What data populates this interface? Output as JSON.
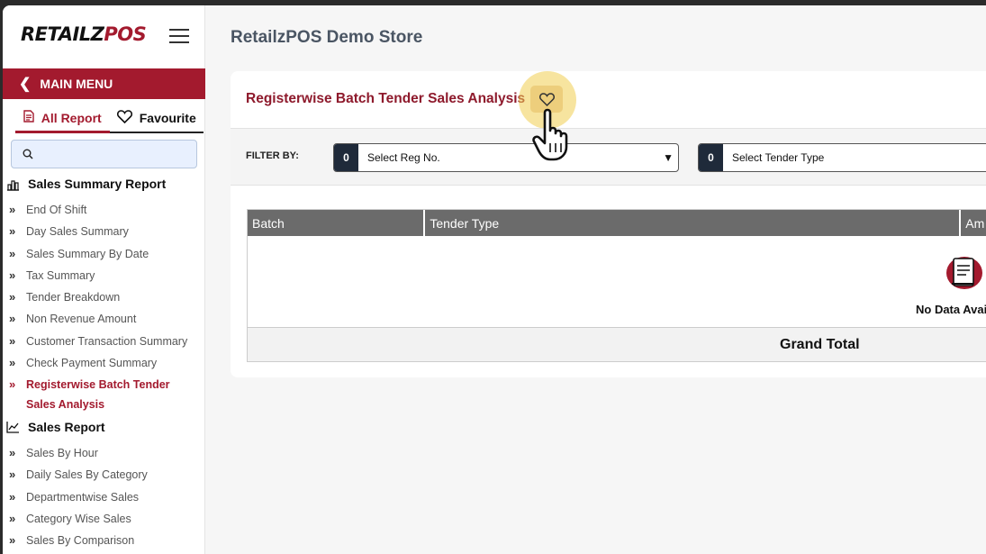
{
  "sidebar": {
    "logo": {
      "part1": "RETAIL",
      "part2": "Z",
      "part3": "POS"
    },
    "main_menu": "MAIN MENU",
    "tabs": [
      {
        "label": "All Report"
      },
      {
        "label": "Favourite"
      }
    ],
    "sections": [
      {
        "title": "Sales Summary Report",
        "items": [
          {
            "label": "End Of Shift"
          },
          {
            "label": "Day Sales Summary"
          },
          {
            "label": "Sales Summary By Date"
          },
          {
            "label": "Tax Summary"
          },
          {
            "label": "Tender Breakdown"
          },
          {
            "label": "Non Revenue Amount"
          },
          {
            "label": "Customer Transaction Summary"
          },
          {
            "label": "Check Payment Summary"
          },
          {
            "label": "Registerwise Batch Tender Sales Analysis"
          }
        ]
      },
      {
        "title": "Sales Report",
        "items": [
          {
            "label": "Sales By Hour"
          },
          {
            "label": "Daily Sales By Category"
          },
          {
            "label": "Departmentwise Sales"
          },
          {
            "label": "Category Wise Sales"
          },
          {
            "label": "Sales By Comparison"
          }
        ]
      }
    ]
  },
  "header": {
    "store_title": "RetailzPOS Demo Store"
  },
  "report": {
    "title": "Registerwise Batch Tender Sales Analysis",
    "filter_label": "FILTER BY:",
    "filters": [
      {
        "count": "0",
        "placeholder": "Select Reg No."
      },
      {
        "count": "0",
        "placeholder": "Select Tender Type"
      }
    ],
    "columns": [
      "Batch",
      "Tender Type",
      "Am"
    ],
    "no_data": "No Data Avai",
    "grand_total": "Grand Total"
  },
  "colors": {
    "brand": "#a31a2e",
    "title": "#8e1a2c",
    "header_bg": "#6b6b6b"
  }
}
